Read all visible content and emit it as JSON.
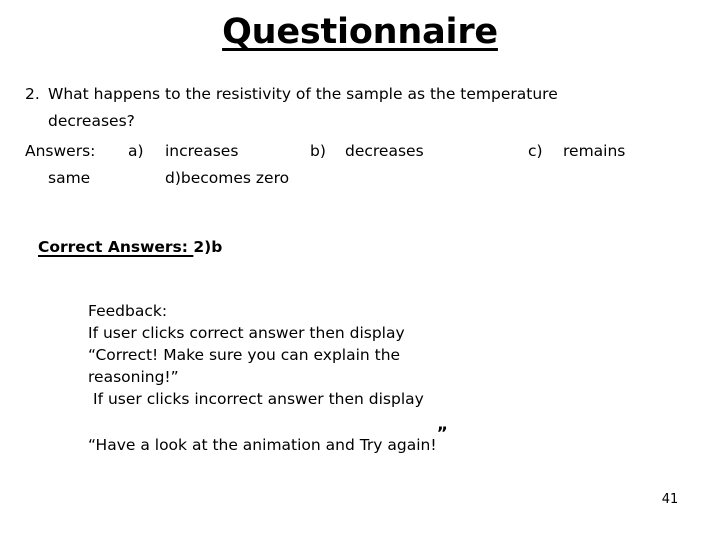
{
  "slide": {
    "title": "Questionnaire",
    "page_number": "41"
  },
  "question": {
    "number": "2.",
    "line1": "What happens to the resistivity of the sample as the temperature",
    "line2": "decreases?"
  },
  "answers": {
    "label": "Answers:",
    "a_key": "a)",
    "a_value": "increases",
    "b_key": "b)",
    "b_value": "decreases",
    "c_key": "c)",
    "c_value": "remains",
    "c_value_cont": "same",
    "d_value": "d)becomes zero"
  },
  "correct": {
    "label": "Correct Answers: ",
    "value": "2)b"
  },
  "feedback": {
    "heading": "Feedback:",
    "line_correct_condition": "If user clicks correct answer then display",
    "line_correct_msg_1": "“Correct! Make sure you can explain the",
    "line_correct_msg_2": "reasoning!”",
    "line_incorrect_condition": "If user clicks incorrect answer then display",
    "line_incorrect_msg": "“Have a look at the animation and Try again!",
    "closing_quote": "”"
  }
}
